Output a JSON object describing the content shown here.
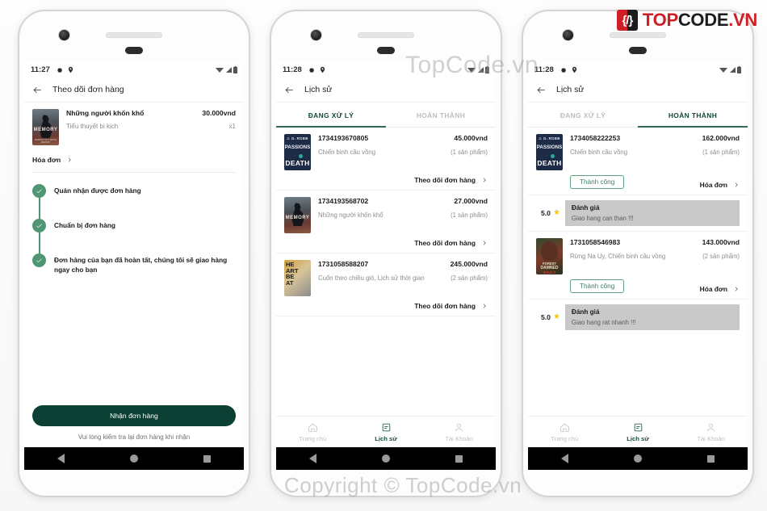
{
  "brand": {
    "mark_glyph": "{/}",
    "part1": "TOP",
    "part2": "CODE",
    "part3": ".VN"
  },
  "watermarks": {
    "top": "TopCode.vn",
    "bottom": "Copyright © TopCode.vn"
  },
  "phone1": {
    "status": {
      "time": "11:27",
      "gear_icon": "gear-icon",
      "location_icon": "location-icon",
      "wifi_icon": "wifi-icon",
      "signal_icon": "signal-icon",
      "battery_icon": "battery-icon"
    },
    "appbar": {
      "back_icon": "back-arrow-icon",
      "title": "Theo dõi đơn hàng"
    },
    "product": {
      "cover": "memory-book-cover",
      "cover_caption": "MEMORY",
      "cover_footer": "MEMORY OF A WHITE MEMORY",
      "title": "Những người khốn khổ",
      "subtitle": "Tiểu thuyết bi kịch",
      "price": "30.000vnd",
      "qty": "x1"
    },
    "invoice": {
      "label": "Hóa đơn",
      "chevron_icon": "chevron-right-icon"
    },
    "timeline": [
      {
        "text": "Quán nhận được đơn hàng",
        "icon": "check-icon"
      },
      {
        "text": "Chuẩn bị đơn hàng",
        "icon": "check-icon"
      },
      {
        "text": "Đơn hàng của bạn đã hoàn tất, chúng tôi sẽ giao hàng ngay cho bạn",
        "icon": "check-icon"
      }
    ],
    "cta": {
      "label": "Nhận đơn hàng",
      "note": "Vui lòng kiểm tra lại đơn hàng khi nhận"
    }
  },
  "phone2": {
    "status": {
      "time": "11:28",
      "gear_icon": "gear-icon",
      "location_icon": "location-icon",
      "wifi_icon": "wifi-icon",
      "signal_icon": "signal-icon",
      "battery_icon": "battery-icon"
    },
    "appbar": {
      "back_icon": "back-arrow-icon",
      "title": "Lịch sử"
    },
    "tabs": [
      {
        "label": "ĐANG XỬ LÝ",
        "active": true
      },
      {
        "label": "HOÀN THÀNH",
        "active": false
      }
    ],
    "orders": [
      {
        "cover": "death-book-cover",
        "cover_l1": "J. D. ROBB",
        "cover_l2": "PASSIONS",
        "cover_l3": "DEATH",
        "id": "1734193670805",
        "names": "Chiến binh cầu vồng",
        "price": "45.000vnd",
        "count": "(1 sản phẩm)",
        "action": "Theo dõi đơn hàng",
        "action_icon": "chevron-right-icon"
      },
      {
        "cover": "memory-book-cover",
        "cover_l1": "",
        "cover_l2": "MEMORY",
        "cover_l3": "",
        "id": "1734193568702",
        "names": "Những người khốn khổ",
        "price": "27.000vnd",
        "count": "(1 sản phẩm)",
        "action": "Theo dõi đơn hàng",
        "action_icon": "chevron-right-icon"
      },
      {
        "cover": "heartbeat-book-cover",
        "cover_l1": "HE ART",
        "cover_l2": "BE AT",
        "cover_l3": "",
        "id": "1731058588207",
        "names": "Cuốn theo chiều gió, Lịch sử thời gian",
        "price": "245.000vnd",
        "count": "(2 sản phẩm)",
        "action": "Theo dõi đơn hàng",
        "action_icon": "chevron-right-icon"
      }
    ],
    "bottomnav": [
      {
        "label": "Trang chủ",
        "icon": "home-icon",
        "active": false
      },
      {
        "label": "Lịch sử",
        "icon": "history-icon",
        "active": true
      },
      {
        "label": "Tài Khoản",
        "icon": "account-icon",
        "active": false
      }
    ]
  },
  "phone3": {
    "status": {
      "time": "11:28",
      "gear_icon": "gear-icon",
      "location_icon": "location-icon",
      "wifi_icon": "wifi-icon",
      "signal_icon": "signal-icon",
      "battery_icon": "battery-icon"
    },
    "appbar": {
      "back_icon": "back-arrow-icon",
      "title": "Lịch sử"
    },
    "tabs": [
      {
        "label": "ĐANG XỬ LÝ",
        "active": false
      },
      {
        "label": "HOÀN THÀNH",
        "active": true
      }
    ],
    "orders": [
      {
        "cover": "death-book-cover",
        "id": "1734058222253",
        "names": "Chiến binh cầu vồng",
        "price": "162.000vnd",
        "count": "(1 sản phẩm)",
        "status_badge": "Thành công",
        "action": "Hóa đơn",
        "action_icon": "chevron-right-icon",
        "review": {
          "score": "5.0",
          "star_icon": "star-icon",
          "title": "Đánh giá",
          "text": "Giao hang can than !!!"
        }
      },
      {
        "cover": "forest-book-cover",
        "id": "1731058546983",
        "names": "Rừng Na Uy, Chiến binh cầu vồng",
        "price": "143.000vnd",
        "count": "(2 sản phẩm)",
        "status_badge": "Thành công",
        "action": "Hóa đơn",
        "action_icon": "chevron-right-icon",
        "review": {
          "score": "5.0",
          "star_icon": "star-icon",
          "title": "Đánh giá",
          "text": "Giao hang rat nhanh !!!"
        }
      }
    ],
    "bottomnav": [
      {
        "label": "Trang chủ",
        "icon": "home-icon",
        "active": false
      },
      {
        "label": "Lịch sử",
        "icon": "history-icon",
        "active": true
      },
      {
        "label": "Tài Khoản",
        "icon": "account-icon",
        "active": false
      }
    ]
  },
  "colors": {
    "primary_dark": "#0c4034",
    "accent_green": "#4f9673",
    "tab_active": "#10473a",
    "review_bg": "#c9c9c9",
    "star": "#f5c518",
    "brand_red": "#cf1f26"
  }
}
